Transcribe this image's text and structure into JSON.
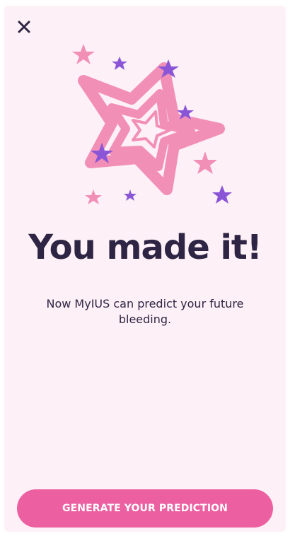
{
  "header": {
    "close_icon": "close-icon"
  },
  "illustration": {
    "icon": "star-burst-illustration",
    "colors": {
      "star": "#f28fb7",
      "accent_pink": "#f28fb7",
      "accent_purple": "#8a55d6"
    }
  },
  "main": {
    "headline": "You made it!",
    "subtitle": "Now MyIUS can predict your future bleeding."
  },
  "footer": {
    "cta_label": "GENERATE YOUR PREDICTION"
  },
  "colors": {
    "background": "#fdf0f6",
    "text": "#2e2544",
    "primary": "#ec5fa0"
  }
}
